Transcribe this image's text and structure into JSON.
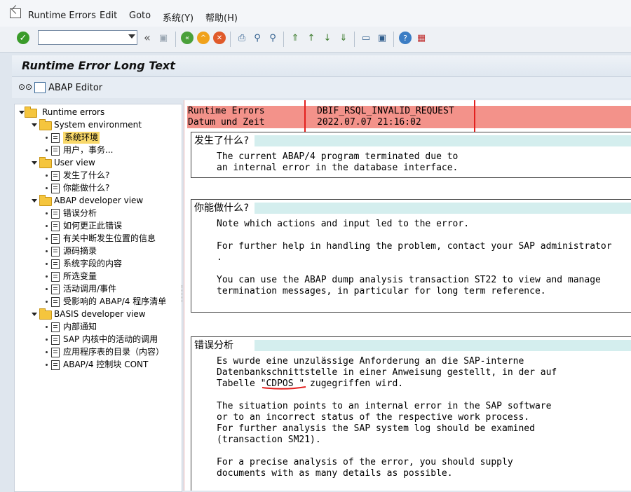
{
  "menu": {
    "items": [
      {
        "label": "Runtime Errors",
        "u": "R"
      },
      {
        "label": "Edit",
        "u": "E"
      },
      {
        "label": "Goto",
        "u": "G"
      },
      {
        "label": "系统(Y)",
        "u": ""
      },
      {
        "label": "帮助(H)",
        "u": ""
      }
    ]
  },
  "toolbar": {
    "icons": [
      "enter-icon",
      "save-icon",
      "back-icon",
      "exit-icon",
      "cancel-icon",
      "print-icon",
      "find-icon",
      "find-next-icon",
      "first-page-icon",
      "prev-page-icon",
      "next-page-icon",
      "last-page-icon",
      "create-session-icon",
      "shortcut-icon",
      "help-icon",
      "customize-layout-icon"
    ],
    "command_value": ""
  },
  "page": {
    "title": "Runtime Error Long Text",
    "abap_editor": "ABAP Editor"
  },
  "tree": {
    "root": "Runtime errors",
    "folders": [
      {
        "label": "System environment",
        "items": [
          "系统环境",
          "用户，事务..."
        ]
      },
      {
        "label": "User view",
        "items": [
          "发生了什么?",
          "你能做什么?"
        ]
      },
      {
        "label": "ABAP developer view",
        "items": [
          "错误分析",
          "如何更正此错误",
          "有关中断发生位置的信息",
          "源码摘录",
          "系统字段的内容",
          "所选变量",
          "活动调用/事件",
          "受影响的 ABAP/4 程序清单"
        ]
      },
      {
        "label": "BASIS developer view",
        "items": [
          "内部通知",
          "SAP 内核中的活动的调用",
          "应用程序表的目录（内容）",
          "ABAP/4 控制块 CONT"
        ]
      }
    ],
    "selected": "系统环境"
  },
  "header": {
    "row1": {
      "key": "Runtime Errors",
      "value": "DBIF_RSQL_INVALID_REQUEST"
    },
    "row2": {
      "key": "Datum und Zeit",
      "value": "2022.07.07 21:16:02"
    }
  },
  "sections": {
    "what_happened": {
      "title": "发生了什么?",
      "lines": [
        "The current ABAP/4 program terminated due to",
        "an internal error in the database interface."
      ]
    },
    "what_can_you_do": {
      "title": "你能做什么?",
      "lines": [
        "Note which actions and input led to the error.",
        "",
        "For further help in handling the problem, contact your SAP administrator",
        ".",
        "",
        "You can use the ABAP dump analysis transaction ST22 to view and manage",
        "termination messages, in particular for long term reference."
      ]
    },
    "error_analysis": {
      "title": "错误分析",
      "lines": [
        "Es wurde eine unzulässige Anforderung an die SAP-interne",
        "Datenbankschnittstelle in einer Anweisung gestellt, in der auf",
        "Tabelle \"CDPOS \" zugegriffen wird.",
        "",
        "The situation points to an internal error in the SAP software",
        "or to an incorrect status of the respective work process.",
        "For further analysis the SAP system log should be examined",
        "(transaction SM21).",
        "",
        "For a precise analysis of the error, you should supply",
        "documents with as many details as possible."
      ]
    }
  },
  "colors": {
    "header_bg": "#f3928a",
    "highlight_box": "#e3201e",
    "section_title_bg": "#d4eeee",
    "selected_bg": "#f8d86a"
  }
}
